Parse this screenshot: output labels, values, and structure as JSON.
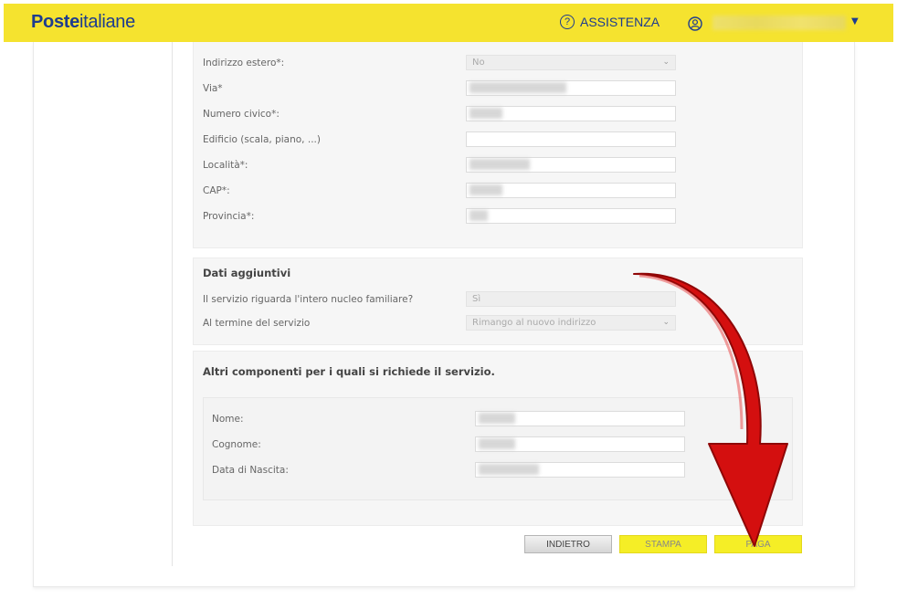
{
  "header": {
    "logo_bold": "Poste",
    "logo_regular": "italiane",
    "assist_label": "ASSISTENZA",
    "assist_icon": "?",
    "user_caret": "▼"
  },
  "address": {
    "fields": [
      {
        "label": "Indirizzo estero*:",
        "type": "select",
        "value": "No"
      },
      {
        "label": "Via*",
        "type": "input"
      },
      {
        "label": "Numero civico*:",
        "type": "input"
      },
      {
        "label": "Edificio (scala, piano, ...)",
        "type": "input"
      },
      {
        "label": "Località*:",
        "type": "input"
      },
      {
        "label": "CAP*:",
        "type": "input"
      },
      {
        "label": "Provincia*:",
        "type": "input"
      }
    ]
  },
  "extra": {
    "title": "Dati aggiuntivi",
    "q1_label": "Il servizio riguarda l'intero nucleo familiare?",
    "q1_value": "Sì",
    "q2_label": "Al termine del servizio",
    "q2_value": "Rimango al nuovo indirizzo"
  },
  "others": {
    "title": "Altri componenti per i quali si richiede il servizio.",
    "name_label": "Nome:",
    "surname_label": "Cognome:",
    "dob_label": "Data di Nascita:"
  },
  "buttons": {
    "back": "INDIETRO",
    "print": "STAMPA",
    "pay": "PAGA"
  },
  "colors": {
    "brand_yellow": "#f5e32f",
    "brand_blue": "#1d3c8f",
    "arrow_red": "#d40f0f"
  }
}
